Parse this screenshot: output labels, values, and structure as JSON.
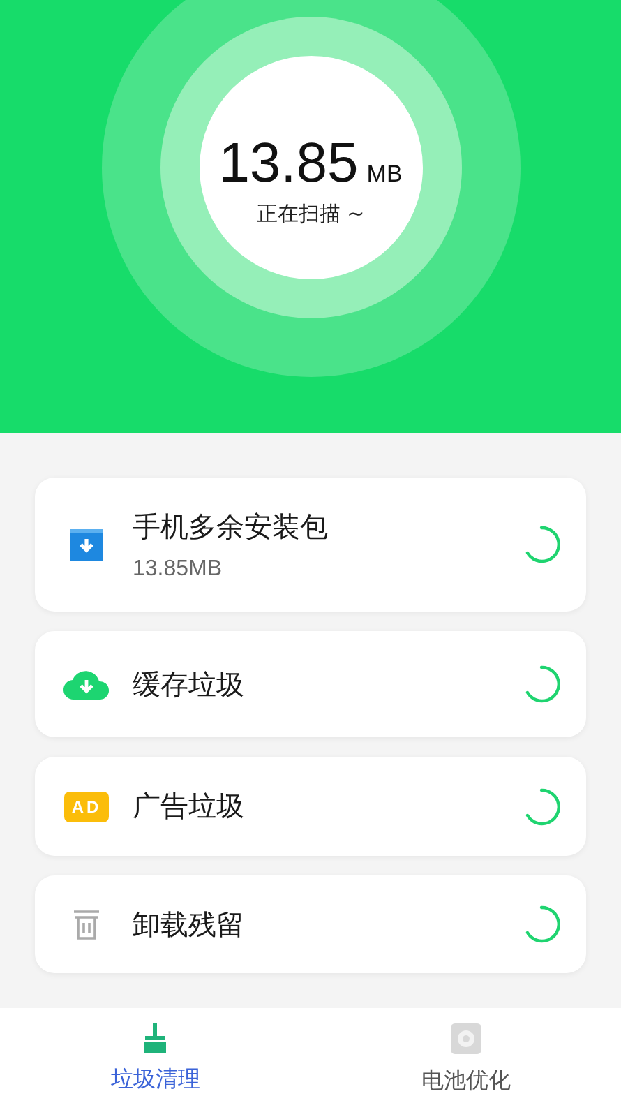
{
  "scan": {
    "size": "13.85",
    "unit": "MB",
    "status": "正在扫描 ~"
  },
  "items": [
    {
      "kind": "package",
      "title": "手机多余安装包",
      "subtitle": "13.85MB"
    },
    {
      "kind": "cache",
      "title": "缓存垃圾"
    },
    {
      "kind": "ad",
      "title": "广告垃圾",
      "badge": "AD"
    },
    {
      "kind": "uninstall",
      "title": "卸载残留"
    }
  ],
  "tabs": [
    {
      "kind": "clean",
      "label": "垃圾清理",
      "selected": true
    },
    {
      "kind": "battery",
      "label": "电池优化",
      "selected": false
    }
  ]
}
